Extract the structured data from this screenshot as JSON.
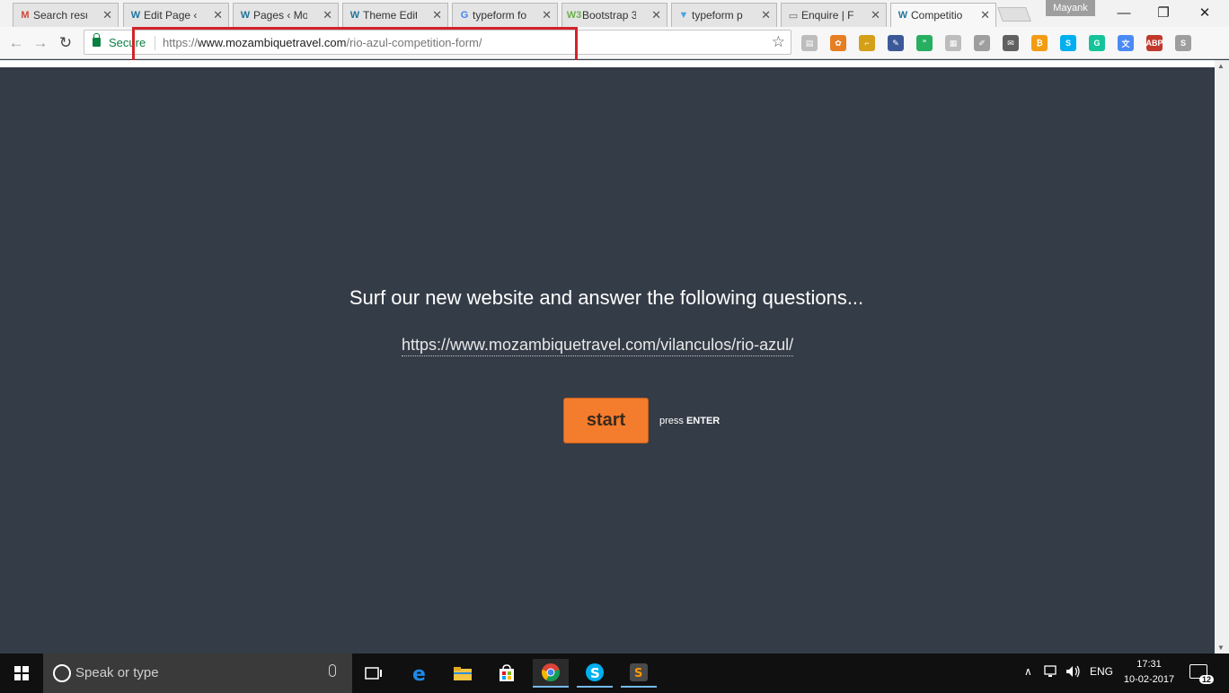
{
  "browser": {
    "tabs": [
      {
        "title": "Search resu",
        "favicon": "gmail-icon",
        "color": "#d44638",
        "glyph": "M"
      },
      {
        "title": "Edit Page ‹",
        "favicon": "wordpress-icon",
        "color": "#21759b",
        "glyph": "W"
      },
      {
        "title": "Pages ‹ Mo",
        "favicon": "wordpress-icon",
        "color": "#21759b",
        "glyph": "W"
      },
      {
        "title": "Theme Edit",
        "favicon": "wordpress-icon",
        "color": "#21759b",
        "glyph": "W"
      },
      {
        "title": "typeform fo",
        "favicon": "google-icon",
        "color": "#4285f4",
        "glyph": "G"
      },
      {
        "title": "Bootstrap 3",
        "favicon": "bootstrap-icon",
        "color": "#6ab04c",
        "glyph": "W3"
      },
      {
        "title": "typeform p",
        "favicon": "typeform-icon",
        "color": "#4aa3df",
        "glyph": "▼"
      },
      {
        "title": "Enquire | F",
        "favicon": "document-icon",
        "color": "#666666",
        "glyph": "▭"
      },
      {
        "title": "Competitio",
        "favicon": "wordpress-icon",
        "color": "#21759b",
        "glyph": "W"
      }
    ],
    "profile_name": "Mayank",
    "window_controls": {
      "minimize": "—",
      "restore": "❐",
      "close": "✕"
    },
    "nav": {
      "back": "←",
      "forward": "→",
      "reload": "↻"
    },
    "omnibox": {
      "secure_label": "Secure",
      "url_scheme": "https://",
      "url_host": "www.mozambiquetravel.com",
      "url_path": "/rio-azul-competition-form/",
      "bookmark_star": "☆"
    },
    "extensions": [
      {
        "name": "reader-extension-icon",
        "color": "#bdbdbd",
        "glyph": "▤"
      },
      {
        "name": "colorpick-extension-icon",
        "color": "#e67e22",
        "glyph": "✿"
      },
      {
        "name": "ruler-extension-icon",
        "color": "#d4a017",
        "glyph": "⌐"
      },
      {
        "name": "eyedropper-extension-icon",
        "color": "#3b5998",
        "glyph": "✎"
      },
      {
        "name": "quotes-extension-icon",
        "color": "#27ae60",
        "glyph": "”"
      },
      {
        "name": "window-resizer-extension-icon",
        "color": "#bdbdbd",
        "glyph": "▦"
      },
      {
        "name": "pencil-extension-icon",
        "color": "#9e9e9e",
        "glyph": "✐"
      },
      {
        "name": "mail-extension-icon",
        "color": "#616161",
        "glyph": "✉"
      },
      {
        "name": "bitcoin-extension-icon",
        "color": "#f39c12",
        "glyph": "₿"
      },
      {
        "name": "skype-extension-icon",
        "color": "#00aff0",
        "glyph": "S"
      },
      {
        "name": "grammarly-extension-icon",
        "color": "#15c39a",
        "glyph": "G"
      },
      {
        "name": "translate-extension-icon",
        "color": "#4a8af4",
        "glyph": "文"
      },
      {
        "name": "adblock-extension-icon",
        "color": "#c0392b",
        "glyph": "ABP"
      },
      {
        "name": "skype-gray-extension-icon",
        "color": "#9e9e9e",
        "glyph": "S"
      }
    ],
    "menu_glyph": "⋮"
  },
  "page": {
    "question": "Surf our new website and answer the following questions...",
    "link": "https://www.mozambiquetravel.com/vilanculos/rio-azul/",
    "start_label": "start",
    "hint_prefix": "press",
    "hint_key": "ENTER",
    "accent_color": "#f47c2d",
    "background_color": "#343c47"
  },
  "taskbar": {
    "search_placeholder": "Speak or type",
    "language": "ENG",
    "time": "17:31",
    "date": "10-02-2017",
    "notification_count": "12",
    "tray_up": "∧"
  }
}
